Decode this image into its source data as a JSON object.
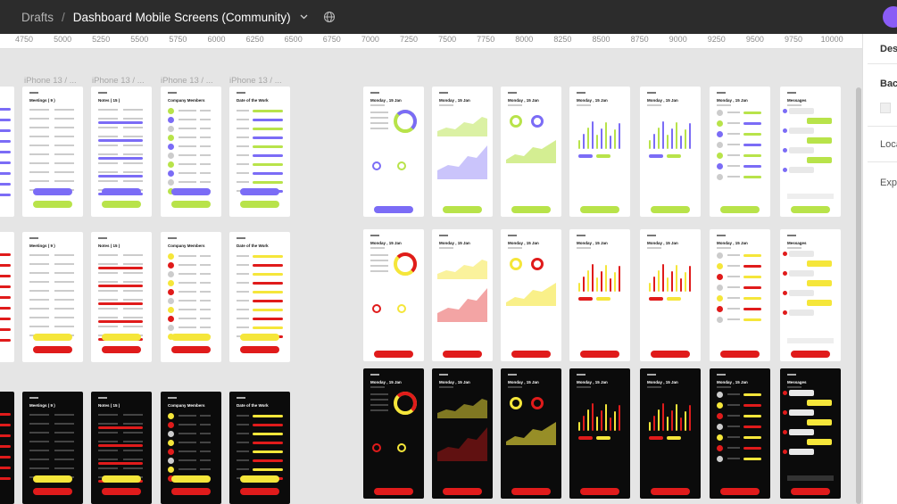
{
  "topbar": {
    "breadcrumb_parent": "Drafts",
    "separator": "/",
    "file_name": "Dashboard Mobile Screens (Community)"
  },
  "ruler": {
    "ticks": [
      "4750",
      "5000",
      "5250",
      "5500",
      "5750",
      "6000",
      "6250",
      "6500",
      "6750",
      "7000",
      "7250",
      "7500",
      "7750",
      "8000",
      "8250",
      "8500",
      "8750",
      "9000",
      "9250",
      "9500",
      "9750",
      "10000"
    ]
  },
  "frame_labels": [
    "iPhone 13 / ...",
    "iPhone 13 / ...",
    "iPhone 13 / ...",
    "iPhone 13 / ..."
  ],
  "right_panel": {
    "tabs": [
      "Desi"
    ],
    "sections": [
      "Back",
      "Loca",
      "Expo"
    ]
  },
  "left_screens": {
    "titles": [
      "Meetings ( 9 )",
      "Notes ( 15 )",
      "Company Members",
      "Date of the Work"
    ]
  },
  "right_screens": {
    "titles": [
      "Monday , 15 Jan",
      "Monday , 15 Jan",
      "Monday , 15 Jan",
      "Monday , 15 Jan",
      "Monday , 15 Jan",
      "Monday , 15 Jan",
      "Messages"
    ]
  },
  "themes": {
    "row1_accent": "#7b6cf6",
    "row1_secondary": "#b8e34a",
    "row2_accent": "#e01b1b",
    "row2_secondary": "#f5e63a",
    "row3_accent": "#e01b1b",
    "row3_secondary": "#f5e63a"
  }
}
